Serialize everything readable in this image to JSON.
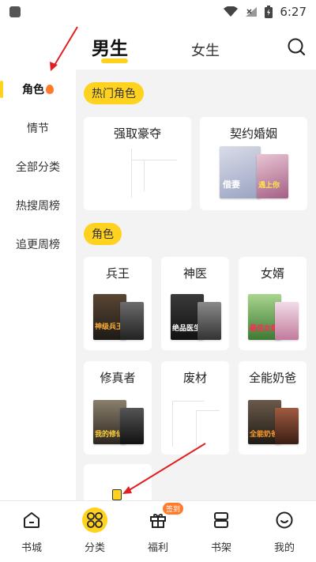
{
  "status_bar": {
    "time": "6:27"
  },
  "header": {
    "tabs": [
      {
        "label": "男生",
        "active": true
      },
      {
        "label": "女生",
        "active": false
      }
    ]
  },
  "sidebar": {
    "items": [
      {
        "label": "角色",
        "active": true
      },
      {
        "label": "情节"
      },
      {
        "label": "全部分类"
      },
      {
        "label": "热搜周榜"
      },
      {
        "label": "追更周榜"
      }
    ]
  },
  "sections": [
    {
      "tag": "热门角色",
      "cards": [
        {
          "title": "强取豪夺"
        },
        {
          "title": "契约婚姻",
          "cover_texts": [
            "借妻",
            "遇上你"
          ]
        }
      ]
    },
    {
      "tag": "角色",
      "cards": [
        {
          "title": "兵王",
          "cover_texts": [
            "神级兵王"
          ]
        },
        {
          "title": "神医",
          "cover_texts": [
            "绝品医生"
          ]
        },
        {
          "title": "女婿",
          "cover_texts": [
            "最佳女婿"
          ]
        },
        {
          "title": "修真者",
          "cover_texts": [
            "我的修仙"
          ]
        },
        {
          "title": "废材"
        },
        {
          "title": "全能奶爸",
          "cover_texts": [
            "全能奶爸"
          ]
        }
      ]
    }
  ],
  "bottom_nav": {
    "items": [
      {
        "label": "书城",
        "icon": "home-icon"
      },
      {
        "label": "分类",
        "icon": "category-icon",
        "active": true
      },
      {
        "label": "福利",
        "icon": "gift-icon",
        "badge": "签到"
      },
      {
        "label": "书架",
        "icon": "bookshelf-icon"
      },
      {
        "label": "我的",
        "icon": "profile-icon"
      }
    ]
  },
  "colors": {
    "accent": "#ffd21f",
    "badge": "#ff7a2b",
    "arrow": "#e02020"
  }
}
